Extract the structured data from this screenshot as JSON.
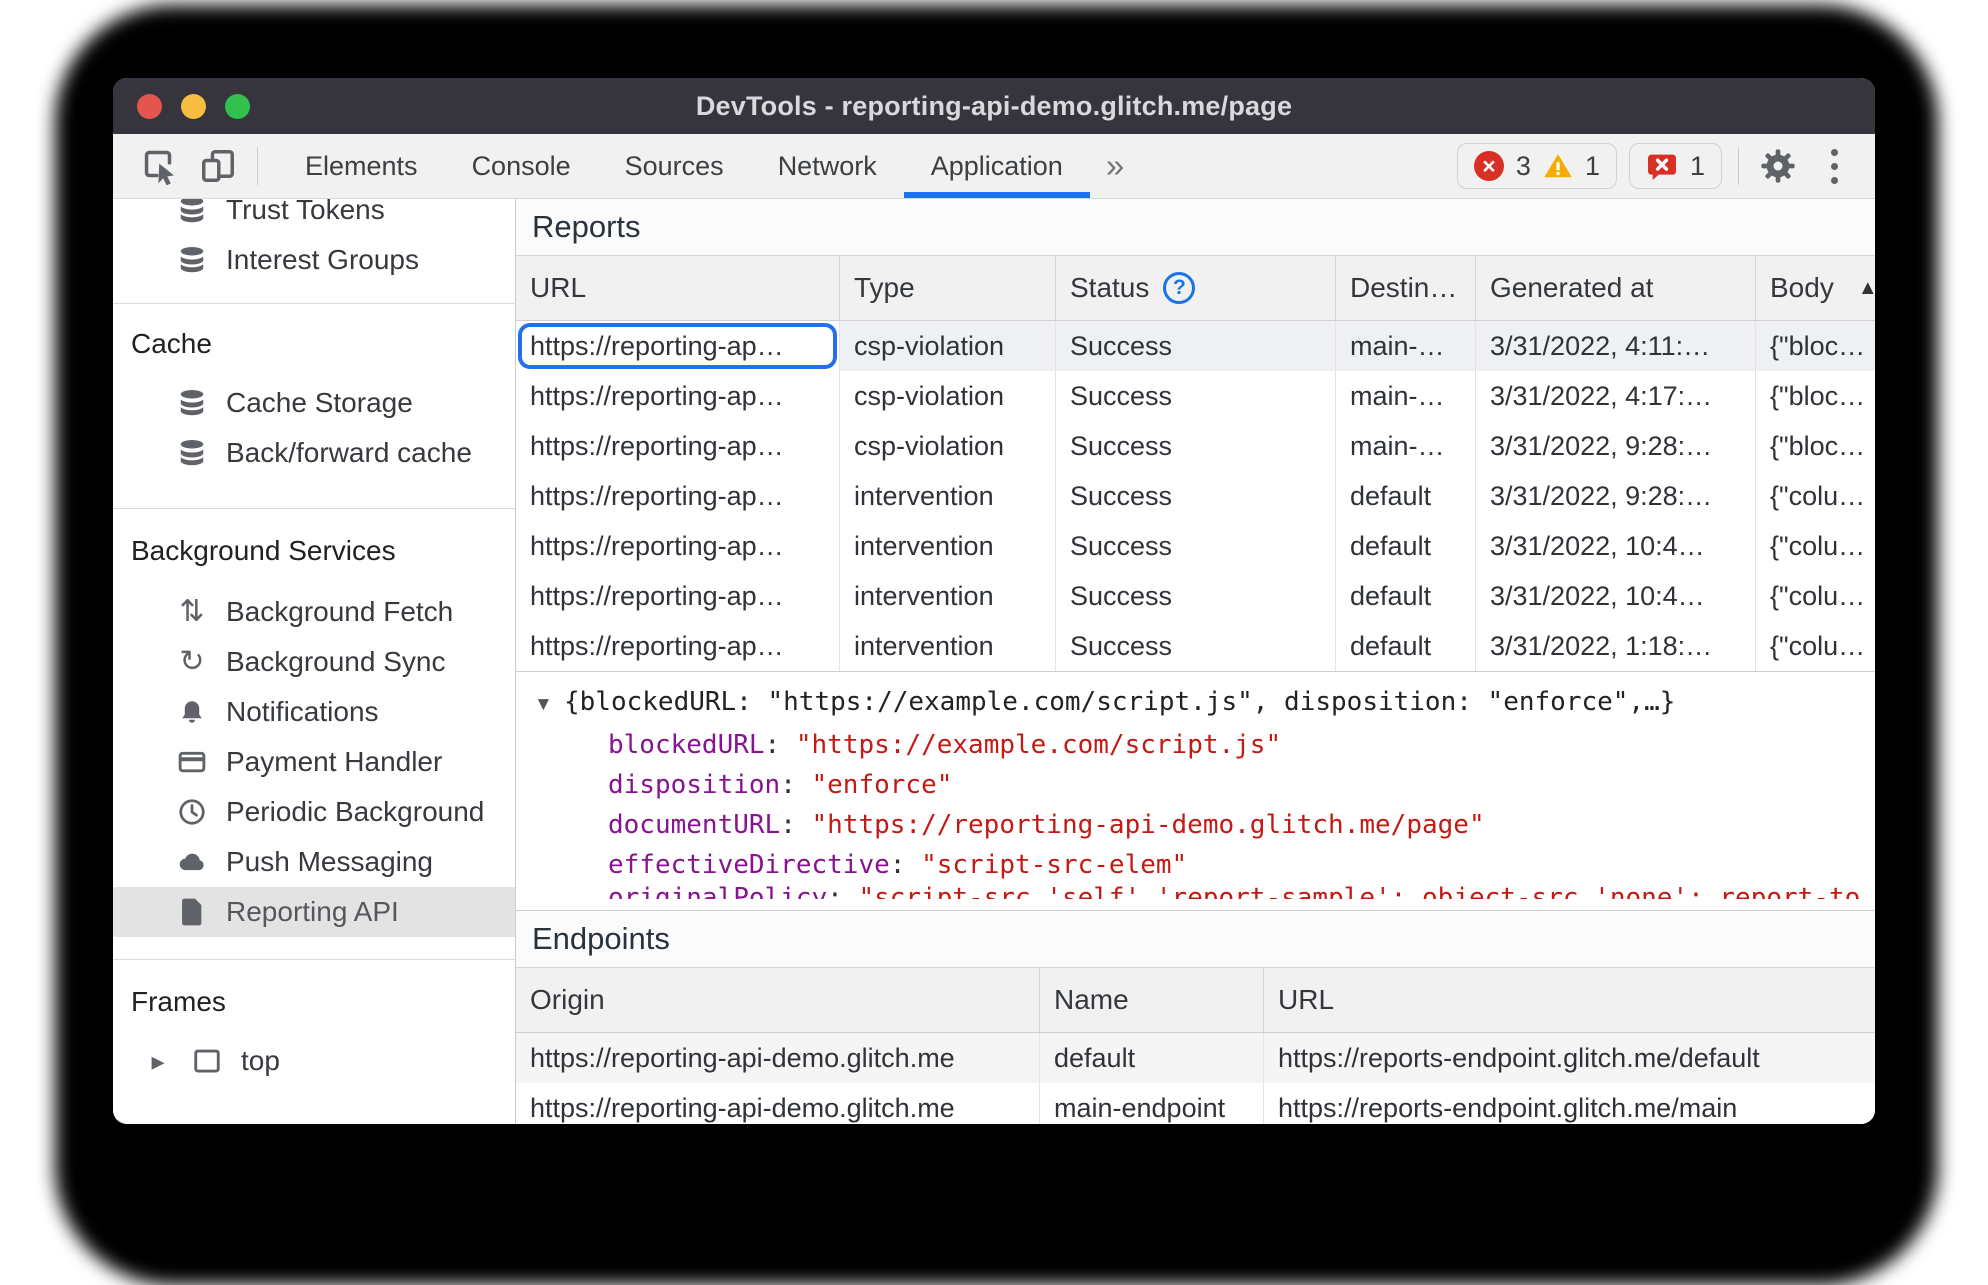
{
  "colors": {
    "accent_blue": "#1a73e8",
    "error_red": "#d93025",
    "warning_orange": "#f6ab00",
    "json_key_purple": "#881391",
    "json_string_red": "#c41a16",
    "titlebar_bg": "#36353d",
    "selected_row_bg": "#eef0f3"
  },
  "titlebar": {
    "title": "DevTools - reporting-api-demo.glitch.me/page"
  },
  "toolbar": {
    "tabs": [
      {
        "label": "Elements"
      },
      {
        "label": "Console"
      },
      {
        "label": "Sources"
      },
      {
        "label": "Network"
      },
      {
        "label": "Application"
      }
    ],
    "more_tabs_glyph": "»",
    "error_count": "3",
    "error_glyph": "×",
    "warning_count": "1",
    "issues_count": "1"
  },
  "sidebar": {
    "trust_tokens": "Trust Tokens",
    "interest_groups": "Interest Groups",
    "cache_header": "Cache",
    "cache_storage": "Cache Storage",
    "back_forward_cache": "Back/forward cache",
    "background_services_header": "Background Services",
    "background_fetch": "Background Fetch",
    "background_sync": "Background Sync",
    "notifications": "Notifications",
    "payment_handler": "Payment Handler",
    "periodic_background": "Periodic Background",
    "push_messaging": "Push Messaging",
    "reporting_api": "Reporting API",
    "frames_header": "Frames",
    "top_frame": "top",
    "caret_glyph": "▸",
    "fetch_glyph": "⇅",
    "sync_glyph": "↻"
  },
  "reports": {
    "title": "Reports",
    "columns": {
      "url": "URL",
      "type": "Type",
      "status": "Status",
      "destination": "Destin…",
      "generated": "Generated at",
      "body": "Body"
    },
    "sort_glyph": "▲",
    "help_glyph": "?",
    "rows": [
      {
        "url": "https://reporting-ap…",
        "type": "csp-violation",
        "status": "Success",
        "destination": "main-…",
        "generated": "3/31/2022, 4:11:…",
        "body": "{\"bloc…"
      },
      {
        "url": "https://reporting-ap…",
        "type": "csp-violation",
        "status": "Success",
        "destination": "main-…",
        "generated": "3/31/2022, 4:17:…",
        "body": "{\"bloc…"
      },
      {
        "url": "https://reporting-ap…",
        "type": "csp-violation",
        "status": "Success",
        "destination": "main-…",
        "generated": "3/31/2022, 9:28:…",
        "body": "{\"bloc…"
      },
      {
        "url": "https://reporting-ap…",
        "type": "intervention",
        "status": "Success",
        "destination": "default",
        "generated": "3/31/2022, 9:28:…",
        "body": "{\"colu…"
      },
      {
        "url": "https://reporting-ap…",
        "type": "intervention",
        "status": "Success",
        "destination": "default",
        "generated": "3/31/2022, 10:4…",
        "body": "{\"colu…"
      },
      {
        "url": "https://reporting-ap…",
        "type": "intervention",
        "status": "Success",
        "destination": "default",
        "generated": "3/31/2022, 10:4…",
        "body": "{\"colu…"
      },
      {
        "url": "https://reporting-ap…",
        "type": "intervention",
        "status": "Success",
        "destination": "default",
        "generated": "3/31/2022, 1:18:…",
        "body": "{\"colu…"
      }
    ]
  },
  "report_detail": {
    "expander_glyph": "▼",
    "preview": "{blockedURL: \"https://example.com/script.js\", disposition: \"enforce\",…}",
    "properties": [
      {
        "key": "blockedURL",
        "colon": ": ",
        "value": "\"https://example.com/script.js\""
      },
      {
        "key": "disposition",
        "colon": ": ",
        "value": "\"enforce\""
      },
      {
        "key": "documentURL",
        "colon": ": ",
        "value": "\"https://reporting-api-demo.glitch.me/page\""
      },
      {
        "key": "effectiveDirective",
        "colon": ": ",
        "value": "\"script-src-elem\""
      }
    ],
    "clipped_property": {
      "key": "originalPolicy",
      "colon": ": ",
      "value": "\"script-src 'self' 'report-sample'; object-src 'none'; report-to main-endpoint\""
    }
  },
  "endpoints": {
    "title": "Endpoints",
    "columns": {
      "origin": "Origin",
      "name": "Name",
      "url": "URL"
    },
    "rows": [
      {
        "origin": "https://reporting-api-demo.glitch.me",
        "name": "default",
        "url": "https://reports-endpoint.glitch.me/default"
      },
      {
        "origin": "https://reporting-api-demo.glitch.me",
        "name": "main-endpoint",
        "url": "https://reports-endpoint.glitch.me/main"
      }
    ]
  }
}
